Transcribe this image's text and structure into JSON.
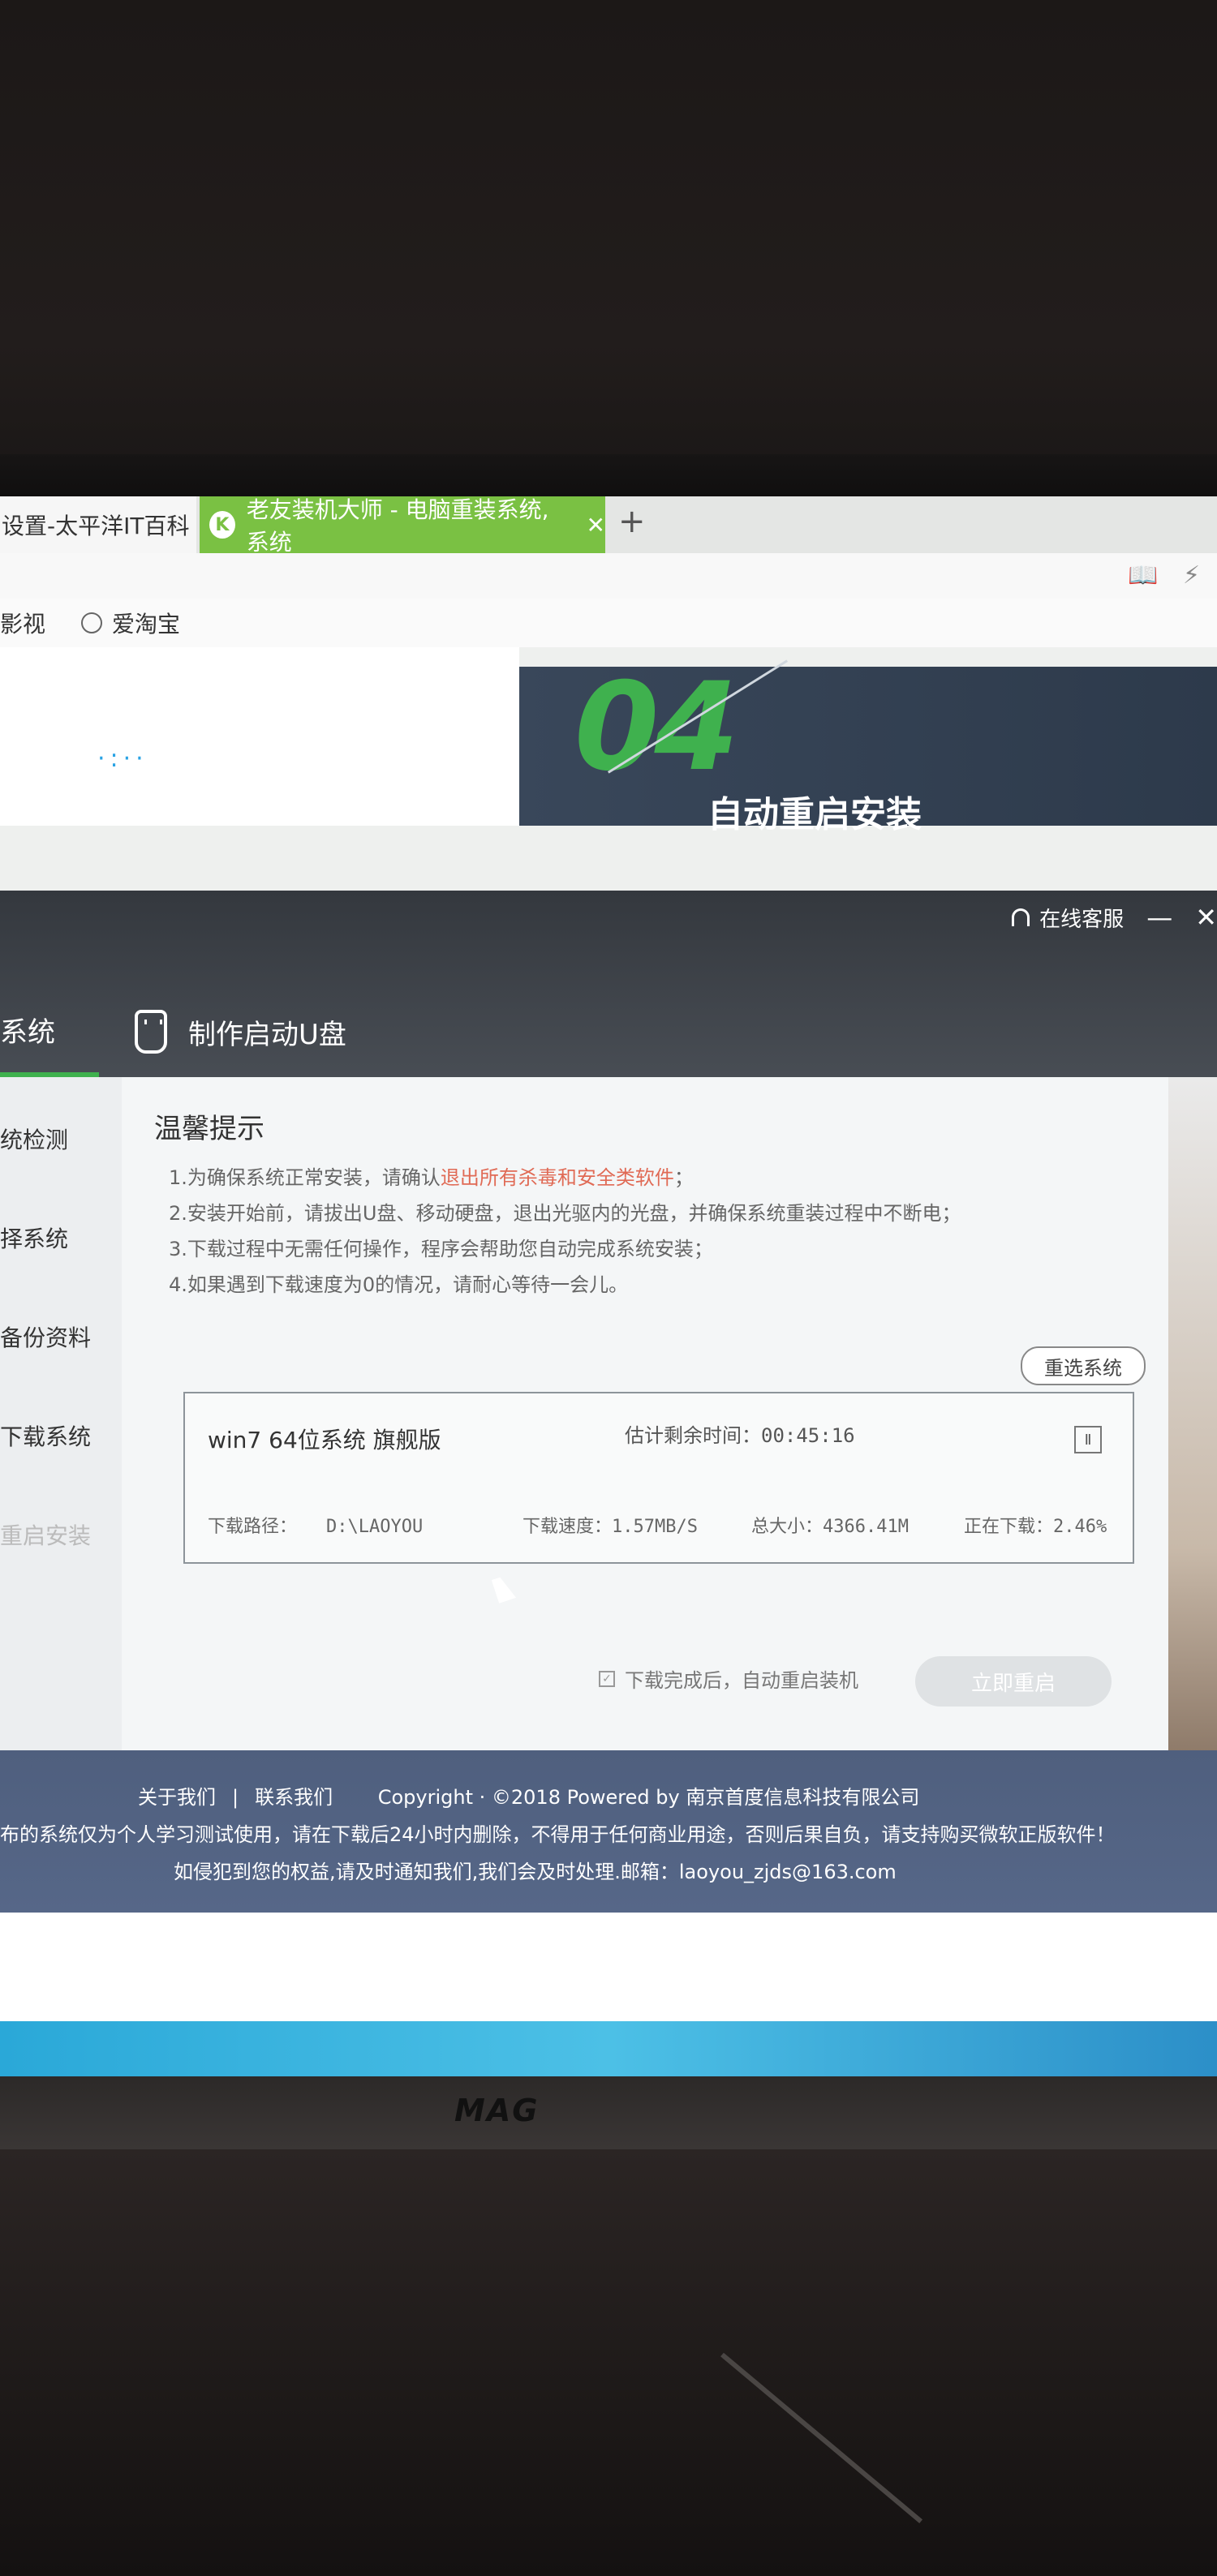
{
  "browser": {
    "tabs": [
      {
        "label": "设置-太平洋IT百科"
      },
      {
        "label": "老友装机大师 - 电脑重装系统,系统",
        "icon_char": "K",
        "close": "✕"
      }
    ],
    "new_tab": "+",
    "bookmarks": [
      {
        "label": "影视"
      },
      {
        "label": "爱淘宝"
      }
    ]
  },
  "hero": {
    "step_number": "04",
    "step_title": "自动重启安装"
  },
  "app": {
    "support_label": "在线客服",
    "minimize": "—",
    "close": "✕",
    "main_tabs": [
      {
        "label": "系统",
        "active": true
      },
      {
        "label": "制作启动U盘",
        "active": false
      }
    ],
    "sidebar_steps": [
      {
        "label": "统检测"
      },
      {
        "label": "择系统"
      },
      {
        "label": "备份资料"
      },
      {
        "label": "下载系统"
      },
      {
        "label": "重启安装"
      }
    ],
    "tips": {
      "title": "温馨提示",
      "items": [
        {
          "prefix": "1.为确保系统正常安装，请确认",
          "highlight": "退出所有杀毒和安全类软件",
          "suffix": "；"
        },
        {
          "prefix": "2.安装开始前，请拔出U盘、移动硬盘，退出光驱内的光盘，并确保系统重装过程中不断电；",
          "highlight": "",
          "suffix": ""
        },
        {
          "prefix": "3.下载过程中无需任何操作，程序会帮助您自动完成系统安装；",
          "highlight": "",
          "suffix": ""
        },
        {
          "prefix": "4.如果遇到下载速度为0的情况，请耐心等待一会儿。",
          "highlight": "",
          "suffix": ""
        }
      ]
    },
    "reselect_button": "重选系统",
    "download": {
      "system_name": "win7 64位系统 旗舰版",
      "eta_label": "估计剩余时间：",
      "eta_value": "00:45:16",
      "path_label": "下载路径：",
      "path_value": "D:\\LAOYOU",
      "speed_label": "下载速度：",
      "speed_value": "1.57MB/S",
      "size_label": "总大小：",
      "size_value": "4366.41M",
      "status_label": "正在下载：",
      "status_value": "2.46%",
      "pause_icon": "Ⅱ"
    },
    "auto_restart_label": "下载完成后，自动重启装机",
    "restart_button": "立即重启"
  },
  "footer": {
    "about": "关于我们",
    "separator": "|",
    "contact": "联系我们",
    "copyright": "Copyright · ©2018 Powered by 南京首度信息科技有限公司",
    "notice": "布的系统仅为个人学习测试使用，请在下载后24小时内删除，不得用于任何商业用途，否则后果自负，请支持购买微软正版软件！",
    "infringement": "如侵犯到您的权益,请及时通知我们,我们会及时处理.邮箱：laoyou_zjds@163.com"
  },
  "monitor": {
    "brand": "MAG"
  },
  "colors": {
    "accent_green": "#3fb14e",
    "tab_green": "#7ac143",
    "header_dark": "#3b4047",
    "footer_blue": "#52638a",
    "warning_red": "#e06a55"
  }
}
